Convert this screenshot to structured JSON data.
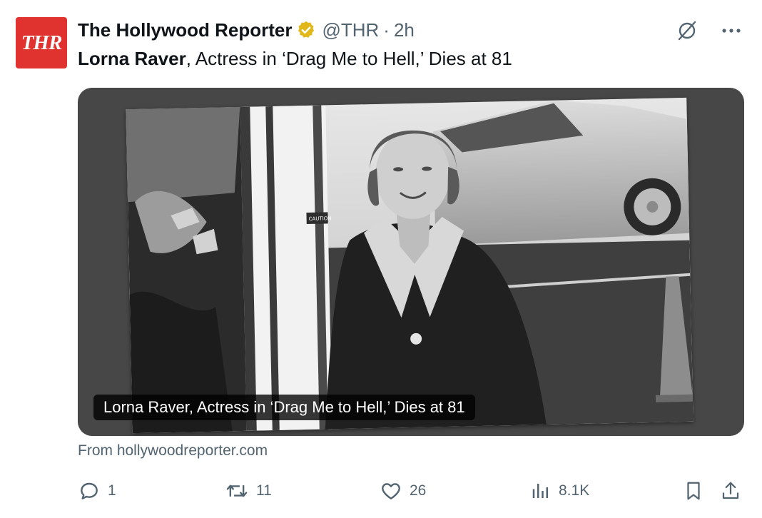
{
  "post": {
    "avatar_text": "THR",
    "display_name": "The Hollywood Reporter",
    "handle": "@THR",
    "separator": "·",
    "time": "2h",
    "text_bold": "Lorna Raver",
    "text_rest": ", Actress in ‘Drag Me to Hell,’ Dies at 81"
  },
  "card": {
    "caption": "Lorna Raver, Actress in ‘Drag Me to Hell,’ Dies at 81",
    "source": "From hollywoodreporter.com",
    "photo_sign_text": "CAUTION"
  },
  "actions": {
    "replies": "1",
    "reposts": "11",
    "likes": "26",
    "views": "8.1K"
  },
  "colors": {
    "avatar_bg": "#e0322e",
    "verified_gold": "#e2b719",
    "text_primary": "#0f1419",
    "text_secondary": "#536471",
    "card_bg": "#474747"
  },
  "icons": [
    "verified-badge-icon",
    "grok-icon",
    "more-icon",
    "reply-icon",
    "repost-icon",
    "like-icon",
    "views-icon",
    "bookmark-icon",
    "share-icon"
  ]
}
